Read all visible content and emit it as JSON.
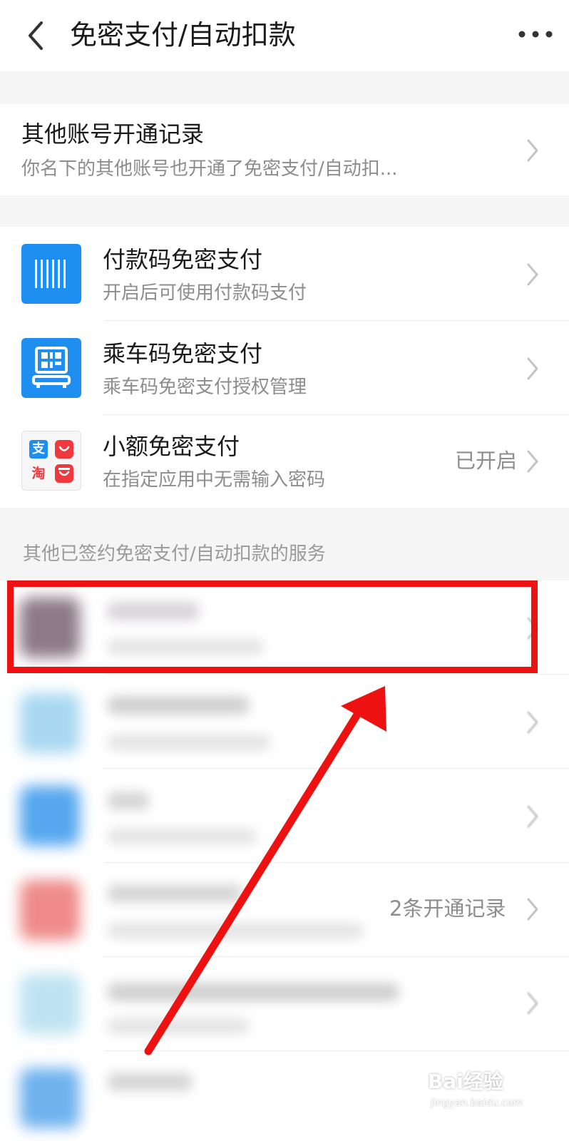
{
  "header": {
    "title": "免密支付/自动扣款"
  },
  "other_accounts": {
    "title": "其他账号开通记录",
    "subtitle": "你名下的其他账号也开通了免密支付/自动扣..."
  },
  "main_items": [
    {
      "title": "付款码免密支付",
      "subtitle": "开启后可使用付款码支付",
      "icon": "barcode-icon",
      "color": "#1e8ff0"
    },
    {
      "title": "乘车码免密支付",
      "subtitle": "乘车码免密支付授权管理",
      "icon": "bus-qr-icon",
      "color": "#1e8ff0"
    },
    {
      "title": "小额免密支付",
      "subtitle": "在指定应用中无需输入密码",
      "status": "已开启",
      "icon": "alipay-taobao-icon"
    }
  ],
  "icon_glyphs": {
    "alipay": "支",
    "taobao": "淘"
  },
  "services_section_label": "其他已签约免密支付/自动扣款的服务",
  "service_rows": [
    {
      "icon_color": "#8d7a86"
    },
    {
      "icon_color": "#a9d8f2"
    },
    {
      "icon_color": "#56a7ef"
    },
    {
      "icon_color": "#ef8a8a",
      "status": "2条开通记录"
    },
    {
      "icon_color": "#bfe3f3"
    },
    {
      "icon_color": "#6fb2ee"
    }
  ],
  "highlight_color": "#ee1111",
  "watermark": {
    "text": "Bai经验",
    "url": "jingyan.baidu.com"
  }
}
